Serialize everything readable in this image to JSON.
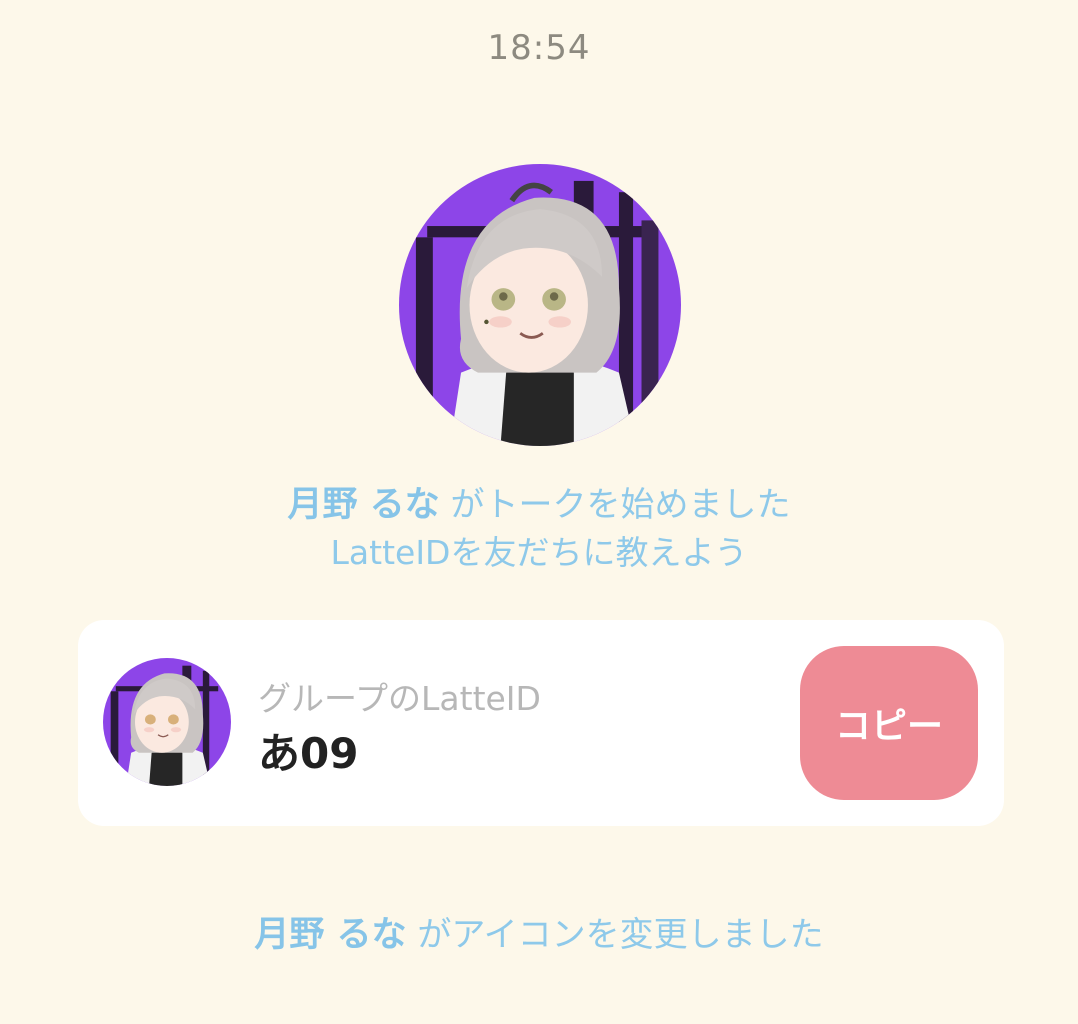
{
  "timestamp": "18:54",
  "colors": {
    "background": "#fdf8ea",
    "notice_text": "#8ec9ea",
    "copy_button": "#ee8b95",
    "avatar_bg": "#8d45e8"
  },
  "avatar": {
    "icon": "user-avatar-anime-character"
  },
  "notices": {
    "start_talk": {
      "user_name": "月野 るな",
      "message": "がトークを始めました"
    },
    "share_id": "LatteIDを友だちに教えよう",
    "icon_changed": {
      "user_name": "月野 るな",
      "message": "がアイコンを変更しました"
    }
  },
  "group_card": {
    "label": "グループのLatteID",
    "value": "あ09",
    "copy_label": "コピー"
  }
}
